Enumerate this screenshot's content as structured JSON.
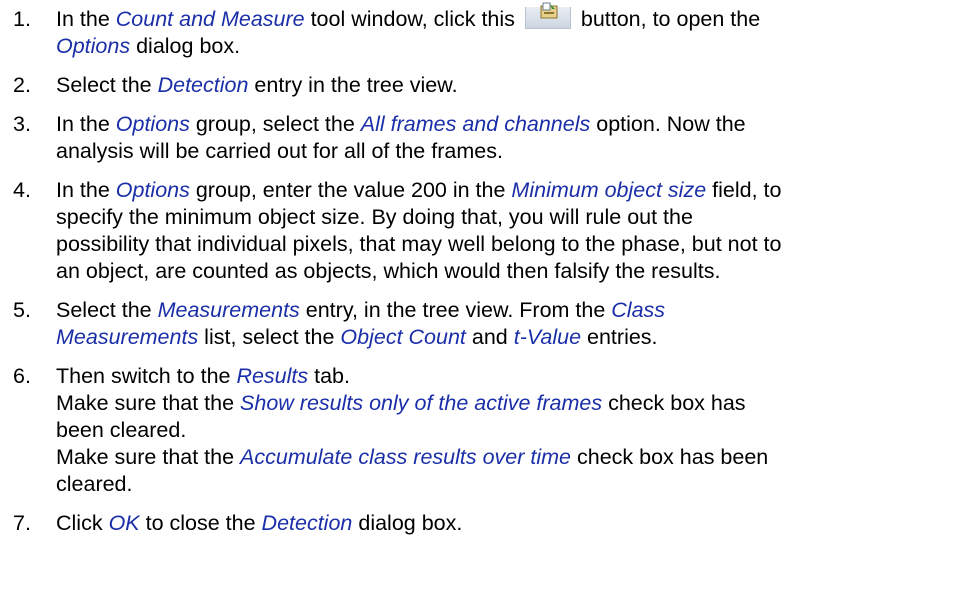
{
  "steps": [
    {
      "num": "1.",
      "t1": "In the ",
      "e1": "Count and Measure",
      "t2": " tool window, click this ",
      "icon": "options-button-icon",
      "t3": " button, to open the",
      "e2": "Options",
      "t4": " dialog box."
    },
    {
      "num": "2.",
      "t1": "Select the ",
      "e1": "Detection",
      "t2": " entry in the tree view."
    },
    {
      "num": "3.",
      "t1": "In the ",
      "e1": "Options",
      "t2": " group, select the ",
      "e2": "All frames and channels",
      "t3": " option. Now the",
      "t4": "analysis will be carried out for all of the frames."
    },
    {
      "num": "4.",
      "t1": "In the ",
      "e1": "Options",
      "t2": " group, enter the value 200 in the ",
      "e2": "Minimum object size",
      "t3": " field, to",
      "t4": "specify the minimum object size. By doing that, you will rule out the",
      "t5": "possibility that individual pixels, that may well belong to the phase, but not to",
      "t6": "an object, are counted as objects, which would then falsify the results."
    },
    {
      "num": "5.",
      "t1": "Select the ",
      "e1": "Measurements",
      "t2": " entry, in the tree view. From the ",
      "e2": "Class",
      "e3": "Measurements",
      "t3": " list, select the ",
      "e4": "Object Count",
      "t4": " and ",
      "e5": "t-Value",
      "t5": " entries."
    },
    {
      "num": "6.",
      "t1": "Then switch to the ",
      "e1": "Results",
      "t2": " tab.",
      "t3": "Make sure that the ",
      "e2": "Show results only of the active frames",
      "t4": " check box has",
      "t5": "been cleared.",
      "t6": "Make sure that the ",
      "e3": "Accumulate class results over time",
      "t7": " check box has been",
      "t8": "cleared."
    },
    {
      "num": "7.",
      "t1": "Click ",
      "e1": "OK",
      "t2": " to close the ",
      "e2": "Detection",
      "t3": " dialog box."
    }
  ]
}
